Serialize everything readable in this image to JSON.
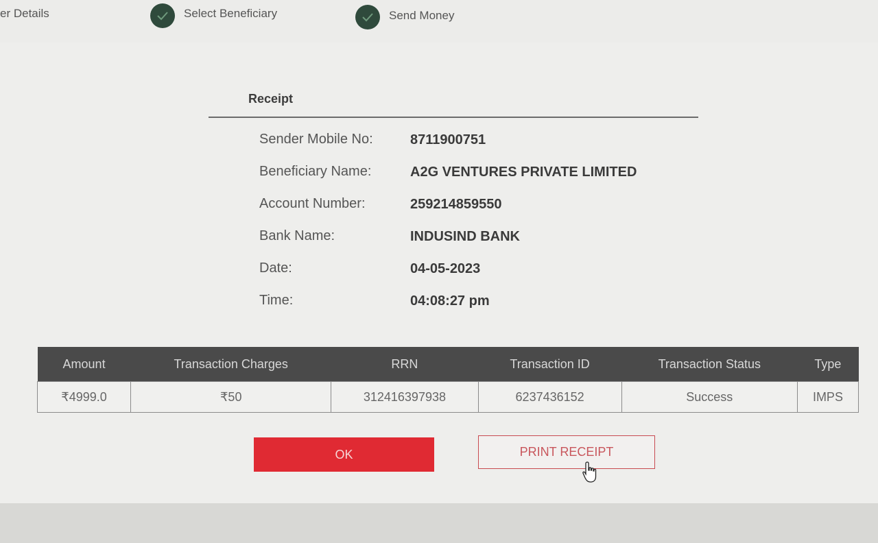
{
  "stepper": {
    "steps": [
      {
        "label": "er Details"
      },
      {
        "label": "Select Beneficiary"
      },
      {
        "label": "Send Money"
      }
    ]
  },
  "receipt": {
    "title": "Receipt",
    "fields": [
      {
        "label": "Sender Mobile No:",
        "value": "8711900751"
      },
      {
        "label": "Beneficiary Name:",
        "value": "A2G VENTURES PRIVATE LIMITED"
      },
      {
        "label": "Account Number:",
        "value": "259214859550"
      },
      {
        "label": "Bank Name:",
        "value": "INDUSIND BANK"
      },
      {
        "label": "Date:",
        "value": "04-05-2023"
      },
      {
        "label": "Time:",
        "value": "04:08:27 pm"
      }
    ]
  },
  "table": {
    "headers": [
      "Amount",
      "Transaction Charges",
      "RRN",
      "Transaction ID",
      "Transaction Status",
      "Type"
    ],
    "row": [
      "₹4999.0",
      "₹50",
      "312416397938",
      "6237436152",
      "Success",
      "IMPS"
    ]
  },
  "actions": {
    "ok_label": "OK",
    "print_label": "PRINT RECEIPT"
  },
  "colors": {
    "primary_button": "#e02a33",
    "step_check": "#2f4a3c",
    "table_header": "#4a4a4a"
  }
}
